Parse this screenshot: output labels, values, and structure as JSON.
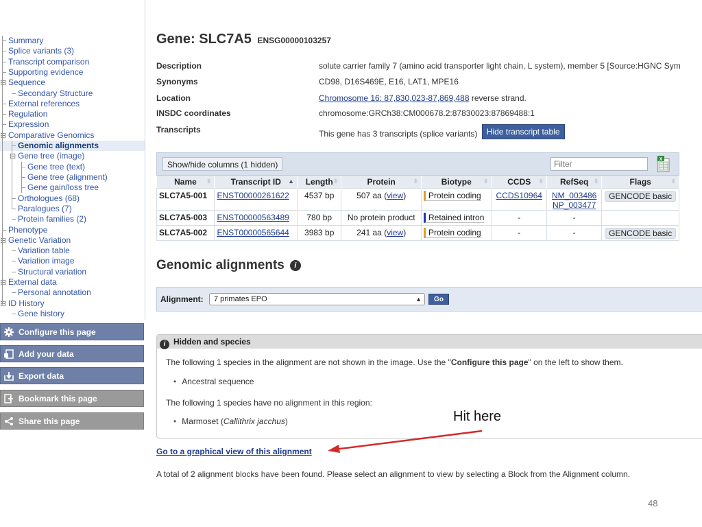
{
  "sidebar": {
    "items": [
      {
        "label": "Summary",
        "prefix": ""
      },
      {
        "label": "Splice variants (3)",
        "prefix": ""
      },
      {
        "label": "Transcript comparison",
        "prefix": ""
      },
      {
        "label": "Supporting evidence",
        "prefix": ""
      },
      {
        "label": "Sequence",
        "prefix": "⊟"
      },
      {
        "label": "Secondary Structure",
        "prefix": ""
      },
      {
        "label": "External references",
        "prefix": ""
      },
      {
        "label": "Regulation",
        "prefix": ""
      },
      {
        "label": "Expression",
        "prefix": ""
      },
      {
        "label": "Comparative Genomics",
        "prefix": "⊟"
      },
      {
        "label": "Genomic alignments",
        "prefix": ""
      },
      {
        "label": "Gene tree (image)",
        "prefix": "⊟"
      },
      {
        "label": "Gene tree (text)",
        "prefix": ""
      },
      {
        "label": "Gene tree (alignment)",
        "prefix": ""
      },
      {
        "label": "Gene gain/loss tree",
        "prefix": ""
      },
      {
        "label": "Orthologues (68)",
        "prefix": ""
      },
      {
        "label": "Paralogues (7)",
        "prefix": ""
      },
      {
        "label": "Protein families (2)",
        "prefix": ""
      },
      {
        "label": "Phenotype",
        "prefix": ""
      },
      {
        "label": "Genetic Variation",
        "prefix": "⊟"
      },
      {
        "label": "Variation table",
        "prefix": ""
      },
      {
        "label": "Variation image",
        "prefix": ""
      },
      {
        "label": "Structural variation",
        "prefix": ""
      },
      {
        "label": "External data",
        "prefix": "⊟"
      },
      {
        "label": "Personal annotation",
        "prefix": ""
      },
      {
        "label": "ID History",
        "prefix": "⊟"
      },
      {
        "label": "Gene history",
        "prefix": ""
      }
    ],
    "current_item": "Genomic alignments",
    "actions": [
      {
        "label": "Configure this page",
        "icon": "gear-icon",
        "style": "blue"
      },
      {
        "label": "Add your data",
        "icon": "add-data-icon",
        "style": "blue"
      },
      {
        "label": "Export data",
        "icon": "export-icon",
        "style": "blue"
      },
      {
        "label": "Bookmark this page",
        "icon": "bookmark-icon",
        "style": "grey"
      },
      {
        "label": "Share this page",
        "icon": "share-icon",
        "style": "grey"
      }
    ]
  },
  "gene": {
    "title": "Gene: SLC7A5",
    "stable_id": "ENSG00000103257"
  },
  "summary": {
    "description_label": "Description",
    "description": "solute carrier family 7 (amino acid transporter light chain, L system), member 5 [Source:HGNC Sym",
    "synonyms_label": "Synonyms",
    "synonyms": "CD98, D16S469E, E16, LAT1, MPE16",
    "location_label": "Location",
    "location_link": "Chromosome 16: 87,830,023-87,869,488",
    "location_suffix": " reverse strand.",
    "insdc_label": "INSDC coordinates",
    "insdc": "chromosome:GRCh38:CM000678.2:87830023:87869488:1",
    "transcripts_label": "Transcripts",
    "transcripts_text": "This gene has 3 transcripts (splice variants)",
    "hide_button": "Hide transcript table"
  },
  "transcript_table": {
    "show_hide_label": "Show/hide columns (1 hidden)",
    "filter_placeholder": "Filter",
    "columns": [
      "Name",
      "Transcript ID",
      "Length",
      "Protein",
      "Biotype",
      "CCDS",
      "RefSeq",
      "Flags"
    ],
    "rows": [
      {
        "name": "SLC7A5-001",
        "transcript_id": "ENST00000261622",
        "length": "4537 bp",
        "protein": "507 aa (",
        "protein_link": "view",
        "protein_suffix": ")",
        "biotype": "Protein coding",
        "ccds": "CCDS10964",
        "refseq": [
          "NM_003486",
          "NP_003477"
        ],
        "flags": "GENCODE basic"
      },
      {
        "name": "SLC7A5-003",
        "transcript_id": "ENST00000563489",
        "length": "780 bp",
        "protein": "No protein product",
        "protein_link": "",
        "protein_suffix": "",
        "biotype": "Retained intron",
        "ccds": "-",
        "refseq": [
          "-"
        ],
        "flags": ""
      },
      {
        "name": "SLC7A5-002",
        "transcript_id": "ENST00000565644",
        "length": "3983 bp",
        "protein": "241 aa (",
        "protein_link": "view",
        "protein_suffix": ")",
        "biotype": "Protein coding",
        "ccds": "-",
        "refseq": [
          "-"
        ],
        "flags": "GENCODE basic"
      }
    ]
  },
  "alignments": {
    "section_title": "Genomic alignments",
    "alignment_label": "Alignment:",
    "alignment_selected": "7 primates EPO",
    "go_label": "Go"
  },
  "hidden_species": {
    "header": "Hidden and species",
    "line1_pre": "The following 1 species in the alignment are not shown in the image. Use the \"",
    "line1_bold": "Configure this page",
    "line1_post": "\" on the left to show them.",
    "bullet1": "Ancestral sequence",
    "line2": "The following 1 species have no alignment in this region:",
    "bullet2_pre": "Marmoset (",
    "bullet2_italic": "Callithrix jacchus",
    "bullet2_post": ")"
  },
  "annotation": {
    "text": "Hit here",
    "arrow_color": "#d42a2a"
  },
  "footer": {
    "graphical_link": "Go to a graphical view of this alignment",
    "total_blocks": "A total of 2 alignment blocks have been found. Please select an alignment to view by selecting a Block from the Alignment column.",
    "page_number": "48"
  },
  "colors": {
    "link": "#1d3c8f",
    "button_blue": "#3e5f9d",
    "sidebar_button": "#6e80a7",
    "sidebar_button_grey": "#9a9a9a",
    "protein_coding": "#d6a12a",
    "retained_intron": "#2233bb"
  }
}
